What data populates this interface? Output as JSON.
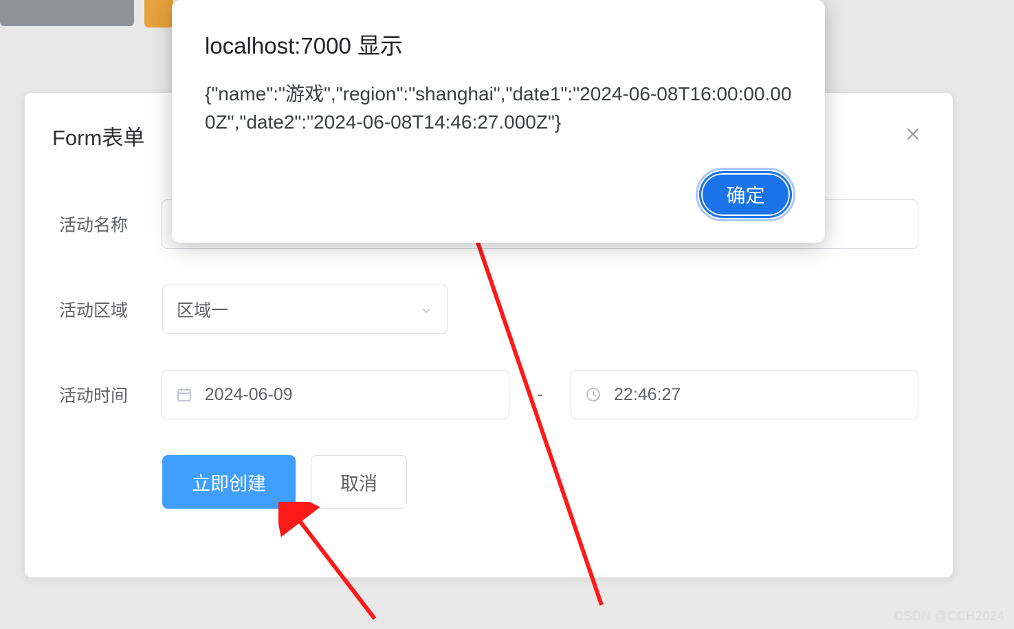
{
  "form": {
    "title": "Form表单",
    "labels": {
      "name": "活动名称",
      "region": "活动区域",
      "time": "活动时间"
    },
    "region_value": "区域一",
    "date_value": "2024-06-09",
    "time_value": "22:46:27",
    "time_dash": "-",
    "submit_label": "立即创建",
    "cancel_label": "取消"
  },
  "alert": {
    "title": "localhost:7000 显示",
    "body": "{\"name\":\"游戏\",\"region\":\"shanghai\",\"date1\":\"2024-06-08T16:00:00.000Z\",\"date2\":\"2024-06-08T14:46:27.000Z\"}",
    "ok": "确定"
  },
  "watermark": "CSDN @CCH2024"
}
